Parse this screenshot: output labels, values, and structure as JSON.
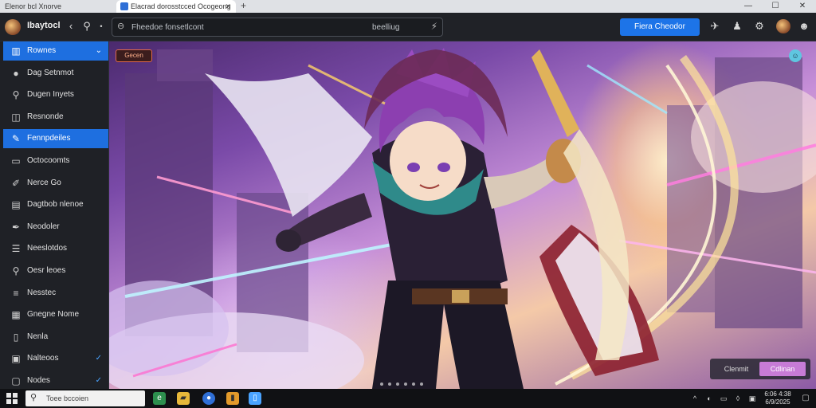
{
  "titlebar": {
    "inactive_tab": "Elenor bcl Xnorve",
    "active_tab": "Elacrad dorosstcced Ocogeong",
    "close_glyph": "✕",
    "new_tab_glyph": "+",
    "minimize_glyph": "—",
    "maximize_glyph": "☐",
    "close_window_glyph": "✕"
  },
  "toolbar": {
    "brand": "Ibaytocl",
    "search_placeholder": "Fheedoe fonsetlcont",
    "search_suffix": "beelliug",
    "primary_button": "Fiera Cheodor"
  },
  "sidebar": {
    "items": [
      {
        "label": "Rownes",
        "icon": "grid-icon",
        "glyph": "▥",
        "chevron": "⌄",
        "selected": true
      },
      {
        "label": "Dag Setnmot",
        "icon": "disc-icon",
        "glyph": "●",
        "chevron": "",
        "selected": false
      },
      {
        "label": "Dugen Inyets",
        "icon": "search-icon",
        "glyph": "⚲",
        "chevron": "",
        "selected": false
      },
      {
        "label": "Resnonde",
        "icon": "layers-icon",
        "glyph": "◫",
        "chevron": "",
        "selected": false
      },
      {
        "label": "Fennpdeiles",
        "icon": "brush-icon",
        "glyph": "✎",
        "chevron": "",
        "selected": true
      },
      {
        "label": "Octocoomts",
        "icon": "monitor-icon",
        "glyph": "▭",
        "chevron": "",
        "selected": false
      },
      {
        "label": "Nerce Go",
        "icon": "edit-icon",
        "glyph": "✐",
        "chevron": "",
        "selected": false
      },
      {
        "label": "Dagtbob nlenoe",
        "icon": "book-icon",
        "glyph": "▤",
        "chevron": "",
        "selected": false
      },
      {
        "label": "Neodoler",
        "icon": "pen-icon",
        "glyph": "✒",
        "chevron": "",
        "selected": false
      },
      {
        "label": "Neeslotdos",
        "icon": "list-icon",
        "glyph": "☰",
        "chevron": "",
        "selected": false
      },
      {
        "label": "Oesr leoes",
        "icon": "magnifier-icon",
        "glyph": "⚲",
        "chevron": "",
        "selected": false
      },
      {
        "label": "Nesstec",
        "icon": "menu-icon",
        "glyph": "≡",
        "chevron": "",
        "selected": false
      },
      {
        "label": "Gnegne Nome",
        "icon": "document-icon",
        "glyph": "▦",
        "chevron": "",
        "selected": false
      },
      {
        "label": "Nenla",
        "icon": "page-icon",
        "glyph": "▯",
        "chevron": "",
        "selected": false
      },
      {
        "label": "Nalteoos",
        "icon": "folder-icon",
        "glyph": "▣",
        "chevron": "✓",
        "selected": false
      },
      {
        "label": "Nodes",
        "icon": "file-icon",
        "glyph": "▢",
        "chevron": "✓",
        "selected": false
      }
    ]
  },
  "main": {
    "badge": "Gecen",
    "bottom_left_button": "Clenmit",
    "bottom_right_button": "Cdlinan"
  },
  "taskbar": {
    "search_text": "Toee bccoien",
    "clock_time": "6:06 4:38",
    "clock_date": "6/9/2025"
  },
  "colors": {
    "accent": "#1e6fe0",
    "pink_button": "#c77bd6"
  }
}
